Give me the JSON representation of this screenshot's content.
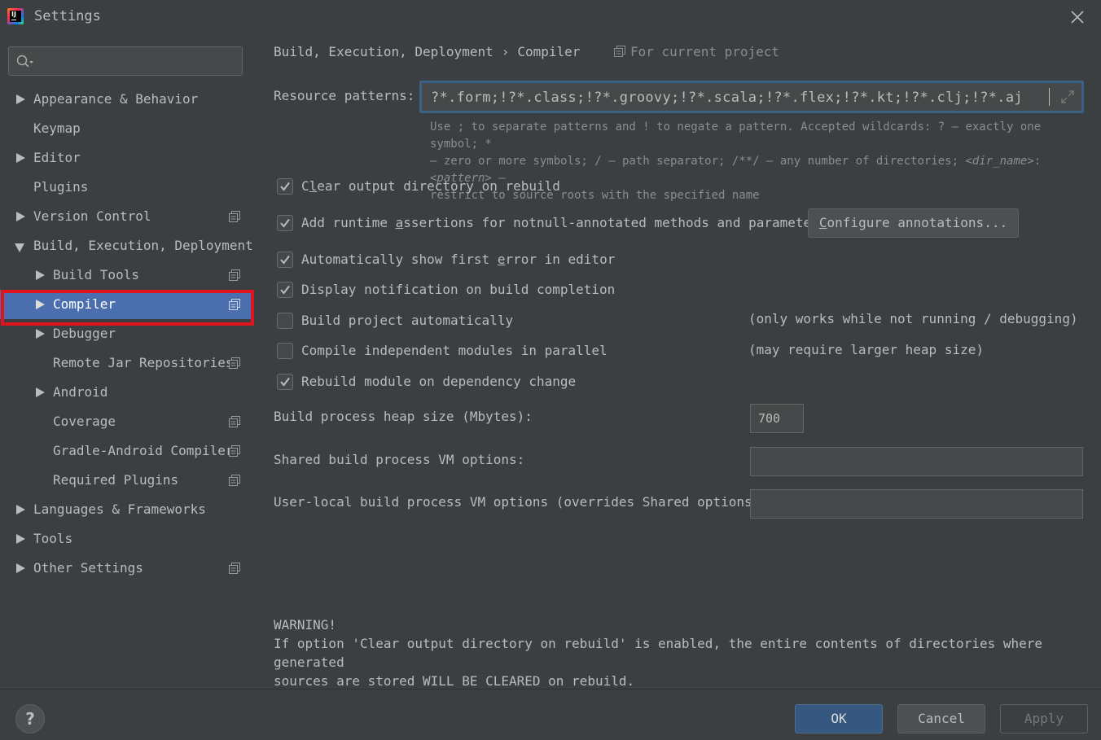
{
  "window": {
    "title": "Settings",
    "app_icon_text": "IJ"
  },
  "sidebar": {
    "search": {
      "value": "",
      "placeholder": ""
    },
    "items": [
      {
        "label": "Appearance & Behavior"
      },
      {
        "label": "Keymap"
      },
      {
        "label": "Editor"
      },
      {
        "label": "Plugins"
      },
      {
        "label": "Version Control"
      },
      {
        "label": "Build, Execution, Deployment"
      },
      {
        "label": "Build Tools"
      },
      {
        "label": "Compiler"
      },
      {
        "label": "Debugger"
      },
      {
        "label": "Remote Jar Repositories"
      },
      {
        "label": "Android"
      },
      {
        "label": "Coverage"
      },
      {
        "label": "Gradle-Android Compiler"
      },
      {
        "label": "Required Plugins"
      },
      {
        "label": "Languages & Frameworks"
      },
      {
        "label": "Tools"
      },
      {
        "label": "Other Settings"
      }
    ],
    "selected": "Compiler"
  },
  "breadcrumb": {
    "parent": "Build, Execution, Deployment",
    "separator": "›",
    "current": "Compiler",
    "scope": "For current project"
  },
  "resource_patterns": {
    "label": "Resource patterns:",
    "value": "?*.form;!?*.class;!?*.groovy;!?*.scala;!?*.flex;!?*.kt;!?*.clj;!?*.aj",
    "hint_line1": "Use ; to separate patterns and ! to negate a pattern. Accepted wildcards: ? — exactly one symbol; *",
    "hint_line2_a": "— zero or more symbols; / — path separator; /**/ — any number of directories; ",
    "hint_line2_dir": "<dir_name>",
    "hint_line2_colon": ":",
    "hint_line2_pattern": "<pattern>",
    "hint_line2_b": " —",
    "hint_line3": "restrict to source roots with the specified name"
  },
  "options": {
    "clear_output": {
      "pre": "C",
      "u": "l",
      "post": "ear output directory on rebuild",
      "checked": true
    },
    "runtime_assertions": {
      "pre": "Add runtime ",
      "u": "a",
      "post": "ssertions for notnull-annotated methods and parameters",
      "checked": true
    },
    "configure_annotations": {
      "pre": "",
      "u": "C",
      "post": "onfigure annotations..."
    },
    "show_first_error": {
      "pre": "Automatically show first ",
      "u": "e",
      "post": "rror in editor",
      "checked": true
    },
    "display_notification": {
      "label": "Display notification on build completion",
      "checked": true
    },
    "build_automatically": {
      "label": "Build project automatically",
      "checked": false,
      "note": "(only works while not running / debugging)"
    },
    "compile_parallel": {
      "label": "Compile independent modules in parallel",
      "checked": false,
      "note": "(may require larger heap size)"
    },
    "rebuild_on_dependency": {
      "label": "Rebuild module on dependency change",
      "checked": true
    }
  },
  "heap": {
    "label": "Build process heap size (Mbytes):",
    "value": "700"
  },
  "shared_vm": {
    "label": "Shared build process VM options:",
    "value": ""
  },
  "user_vm": {
    "label": "User-local build process VM options (overrides Shared options):",
    "value": ""
  },
  "warning": {
    "title": "WARNING!",
    "line1": "If option 'Clear output directory on rebuild' is enabled, the entire contents of directories where generated",
    "line2": "sources are stored WILL BE CLEARED on rebuild."
  },
  "footer": {
    "help": "?",
    "ok": "OK",
    "cancel": "Cancel",
    "apply": "Apply"
  },
  "colors": {
    "background": "#3c3f41",
    "selection": "#4b6eaf",
    "highlight_outline": "#e0141e",
    "primary_button": "#365880"
  }
}
